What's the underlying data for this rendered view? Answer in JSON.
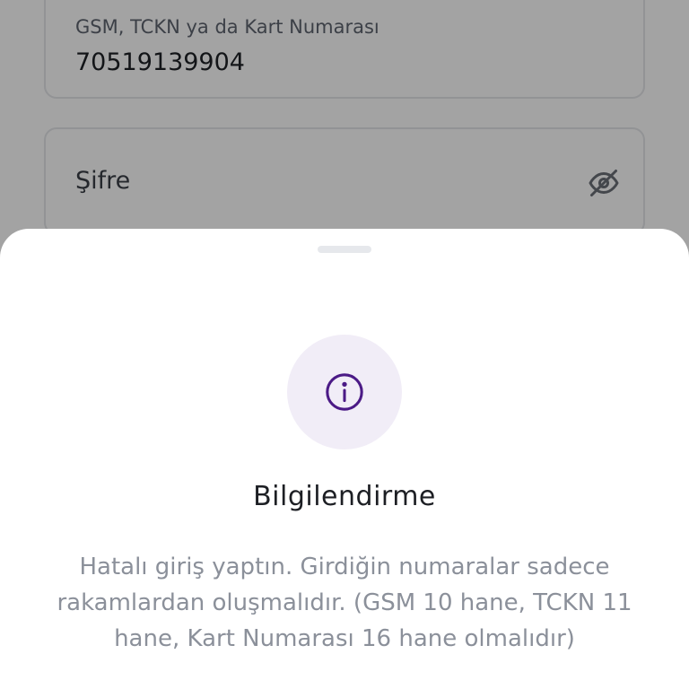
{
  "form": {
    "id_field": {
      "label": "GSM, TCKN ya da Kart Numarası",
      "value": "70519139904"
    },
    "password_field": {
      "placeholder": "Şifre",
      "toggle_icon": "eye-off-icon"
    }
  },
  "sheet": {
    "icon": "info-icon",
    "title": "Bilgilendirme",
    "message": "Hatalı giriş yaptın. Girdiğin numaralar sadece rakamlardan oluşmalıdır. (GSM  10 hane, TCKN 11 hane, Kart Numarası 16 hane olmalıdır)"
  },
  "colors": {
    "accent": "#4b1a86",
    "icon_bg": "#f1edf7"
  }
}
